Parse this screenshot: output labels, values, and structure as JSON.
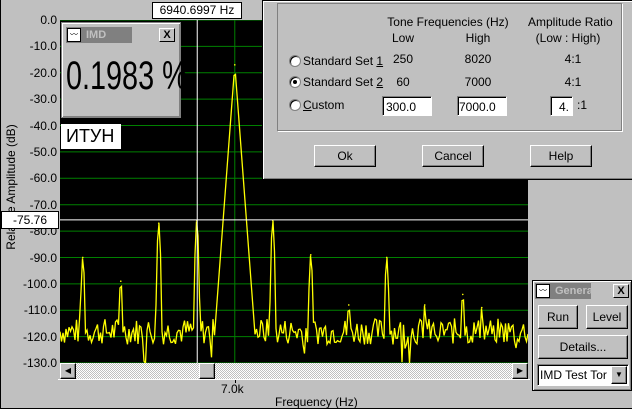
{
  "spectrum": {
    "cursor_frequency": "6940.6997 Hz",
    "cursor_amplitude": "-75.76",
    "y_axis_label": "Relative Amplitude (dB)",
    "x_axis_label": "Frequency (Hz)",
    "y_ticks": [
      "0.0",
      "-10.0",
      "-20.0",
      "-30.0",
      "-40.0",
      "-50.0",
      "-60.0",
      "-70.0",
      "-80.0",
      "-90.0",
      "-100.0",
      "-110.0",
      "-120.0",
      "-130.0"
    ],
    "x_tick": "7.0k",
    "overlay_label": "ИТУН",
    "colors": {
      "trace": "#ffff00",
      "grid": "#008000",
      "cursor": "#ffffff",
      "background": "#000000"
    }
  },
  "chart_data": {
    "type": "line",
    "xlabel": "Frequency (Hz)",
    "ylabel": "Relative Amplitude (dB)",
    "ylim": [
      -130,
      0
    ],
    "xlim": [
      6724,
      7463
    ],
    "x_tick_labels": [
      "7.0k"
    ],
    "grid": true,
    "noise_floor_db": -118,
    "peaks": [
      {
        "x": 6760,
        "y": -90
      },
      {
        "x": 6820,
        "y": -99
      },
      {
        "x": 6880,
        "y": -77
      },
      {
        "x": 6940,
        "y": -76
      },
      {
        "x": 7000,
        "y": -17
      },
      {
        "x": 7060,
        "y": -76
      },
      {
        "x": 7120,
        "y": -89
      },
      {
        "x": 7180,
        "y": -108
      },
      {
        "x": 7240,
        "y": -90
      },
      {
        "x": 7300,
        "y": -108
      },
      {
        "x": 7360,
        "y": -104
      },
      {
        "x": 7390,
        "y": -109
      }
    ],
    "cursor": {
      "x": 6940.6997,
      "y": -75.76
    }
  },
  "imd_window": {
    "title": "IMD",
    "value": "0.1983 %",
    "close": "X"
  },
  "dialog": {
    "header_freq": "Tone Frequencies (Hz)",
    "header_low": "Low",
    "header_high": "High",
    "header_ratio": "Amplitude Ratio",
    "header_ratio_sub": "(Low : High)",
    "rows": [
      {
        "label_pre": "Standard Set ",
        "label_key": "1",
        "low": "250",
        "high": "8020",
        "ratio": "4:1",
        "selected": false
      },
      {
        "label_pre": "Standard Set ",
        "label_key": "2",
        "low": "60",
        "high": "7000",
        "ratio": "4:1",
        "selected": true
      }
    ],
    "custom": {
      "label_key": "C",
      "label_rest": "ustom",
      "low": "300.0",
      "high": "7000.0",
      "ratio": "4.",
      "ratio_suffix": ":1"
    },
    "ok": "Ok",
    "cancel": "Cancel",
    "help": "Help"
  },
  "generator": {
    "title": "Genera",
    "close": "X",
    "run": "Run",
    "level": "Level",
    "details": "Details...",
    "waveform": "IMD Test Tor"
  }
}
